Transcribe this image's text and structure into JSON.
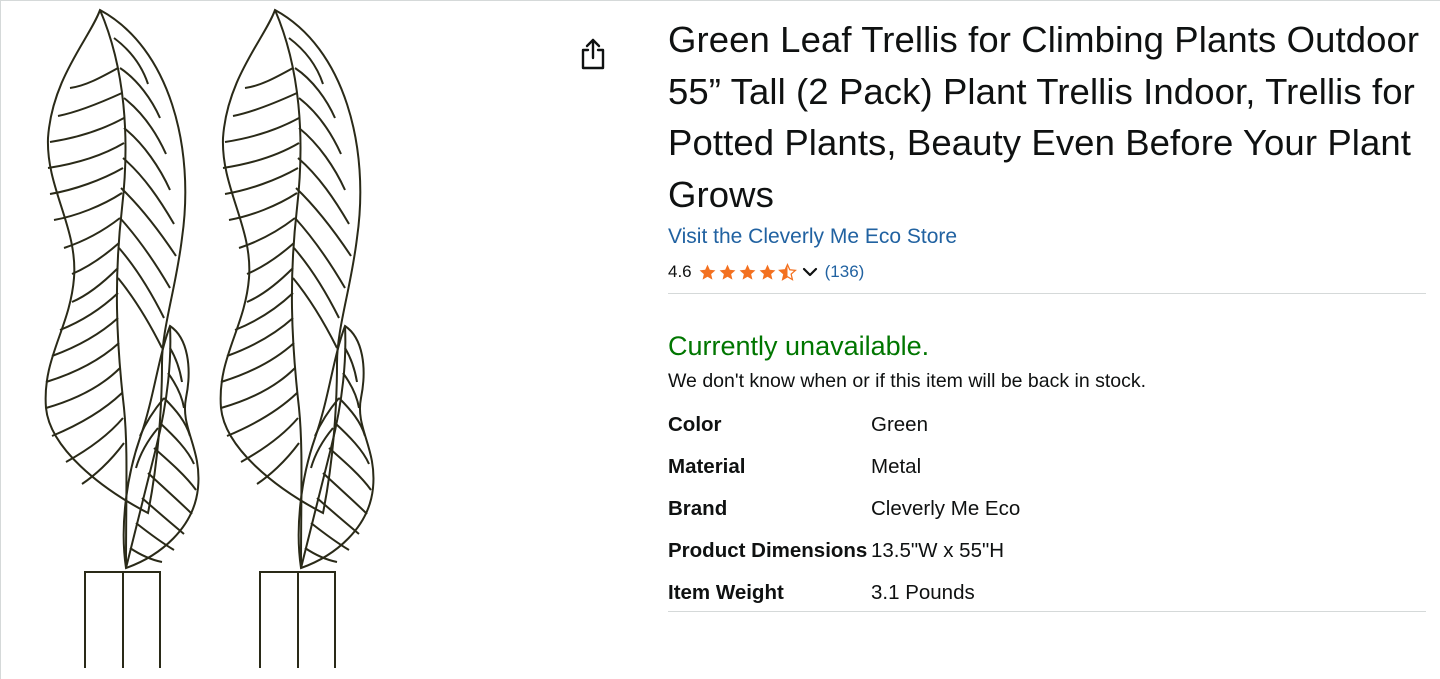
{
  "product": {
    "title": "Green Leaf Trellis for Climbing Plants Outdoor 55” Tall (2 Pack) Plant Trellis Indoor, Trellis for Potted Plants, Beauty Even Before Your Plant Grows",
    "store_link": "Visit the Cleverly Me Eco Store",
    "image_icon": "leaf-trellis-product-image",
    "share_icon": "share-icon"
  },
  "rating": {
    "value": "4.6",
    "stars": 4.5,
    "review_count": "(136)",
    "star_color": "#f3701f"
  },
  "availability": {
    "status": "Currently unavailable.",
    "note": "We don't know when or if this item will be back in stock.",
    "status_color": "#007600"
  },
  "specs": [
    {
      "label": "Color",
      "value": "Green"
    },
    {
      "label": "Material",
      "value": "Metal"
    },
    {
      "label": "Brand",
      "value": "Cleverly Me Eco"
    },
    {
      "label": "Product Dimensions",
      "value": "13.5\"W x 55\"H"
    },
    {
      "label": "Item Weight",
      "value": "3.1 Pounds"
    }
  ],
  "colors": {
    "link": "#2162a1",
    "trellis": "#2a2a18"
  }
}
